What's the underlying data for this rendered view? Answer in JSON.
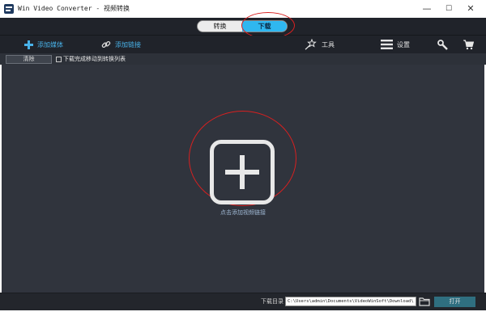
{
  "window": {
    "title": "Win Video Converter - 视频转换",
    "minimize_glyph": "—",
    "maximize_glyph": "☐",
    "close_glyph": "✕"
  },
  "mode_tabs": {
    "convert_label": "转换",
    "download_label": "下载",
    "active": "下载",
    "active_color": "#2fb7f0"
  },
  "toolbar": {
    "add_media_label": "添加媒体",
    "add_link_label": "添加链接",
    "tools_label": "工具",
    "settings_label": "设置",
    "icons": [
      "plus-icon",
      "link-icon",
      "magic-wand-icon",
      "menu-icon",
      "wrench-icon",
      "cart-icon"
    ]
  },
  "subbar": {
    "clear_label": "清除",
    "move_label": "下载完成移动到转换列表",
    "move_checked": false
  },
  "main": {
    "drop_hint": "点击添加视频链接",
    "highlight_color": "#d82020"
  },
  "bottom": {
    "dir_label": "下载目录",
    "dir_value": "C:\\Users\\admin\\Documents\\VideoWinSoft\\Download\\",
    "open_label": "打开"
  },
  "colors": {
    "toolbar_bg": "#20232a",
    "main_bg": "#30343d",
    "accent": "#49b3ea"
  }
}
